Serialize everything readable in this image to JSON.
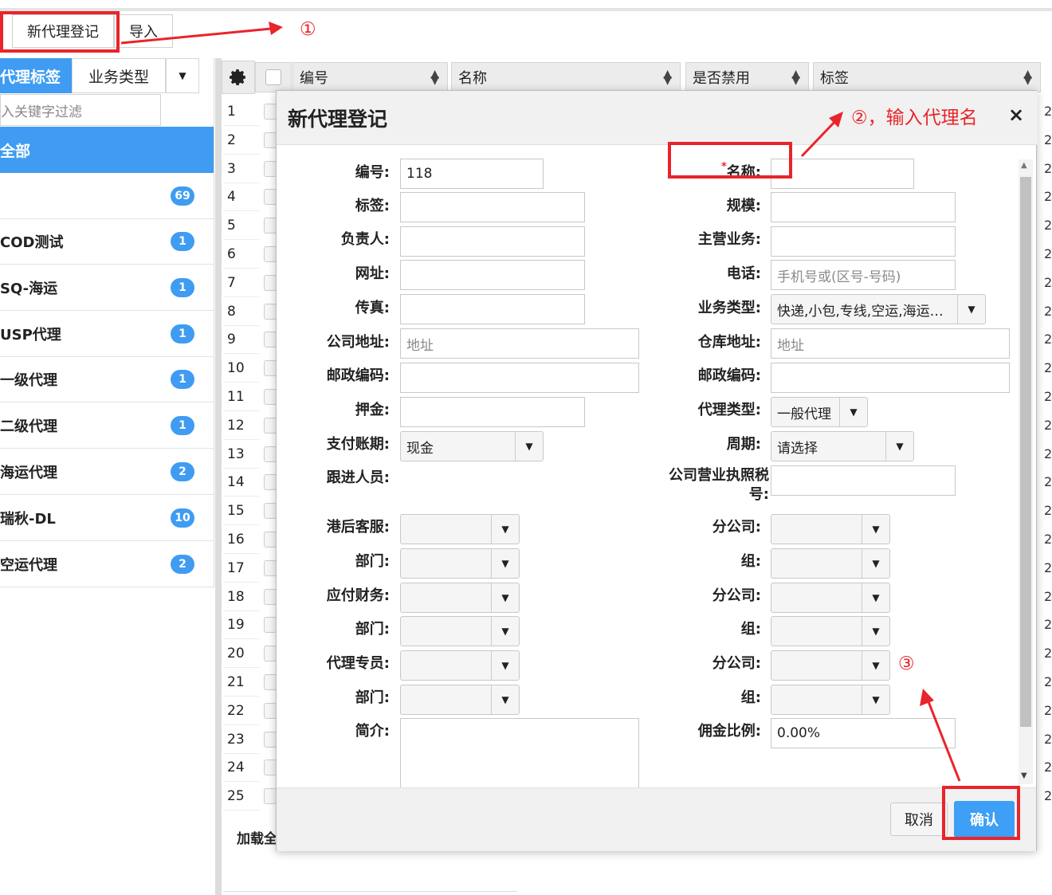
{
  "toolbar": {
    "new_label": "新代理登记",
    "import_label": "导入"
  },
  "annotations": {
    "step1": "①",
    "step2": "②，输入代理名",
    "step3": "③"
  },
  "left_panel": {
    "tab_tags": "代理标签",
    "tab_business": "业务类型",
    "filter_placeholder": "入关键字过滤",
    "all_label": "全部",
    "items": [
      {
        "label": "",
        "count": "69"
      },
      {
        "label": "COD测试",
        "count": "1"
      },
      {
        "label": "SQ-海运",
        "count": "1"
      },
      {
        "label": "USP代理",
        "count": "1"
      },
      {
        "label": "一级代理",
        "count": "1"
      },
      {
        "label": "二级代理",
        "count": "1"
      },
      {
        "label": "海运代理",
        "count": "2"
      },
      {
        "label": "瑞秋-DL",
        "count": "10"
      },
      {
        "label": "空运代理",
        "count": "2"
      }
    ]
  },
  "grid": {
    "columns": [
      "编号",
      "名称",
      "是否禁用",
      "标签"
    ],
    "rows": [
      "1",
      "2",
      "3",
      "4",
      "5",
      "6",
      "7",
      "8",
      "9",
      "10",
      "11",
      "12",
      "13",
      "14",
      "15",
      "16",
      "17",
      "18",
      "19",
      "20",
      "21",
      "22",
      "23",
      "24",
      "25"
    ],
    "right_cell": "2",
    "load_label": "加载全部"
  },
  "dialog": {
    "title": "新代理登记",
    "close": "×",
    "labels": {
      "code": "编号:",
      "name": "名称:",
      "tag": "标签:",
      "scale": "规模:",
      "owner": "负责人:",
      "main_business": "主营业务:",
      "website": "网址:",
      "phone": "电话:",
      "fax": "传真:",
      "business_type": "业务类型:",
      "company_address": "公司地址:",
      "warehouse_address": "仓库地址:",
      "postcode1": "邮政编码:",
      "postcode2": "邮政编码:",
      "deposit": "押金:",
      "agent_type": "代理类型:",
      "payment_term": "支付账期:",
      "period": "周期:",
      "follower": "跟进人员:",
      "tax_no": "公司营业执照税号:",
      "port_cs": "港后客服:",
      "branch1": "分公司:",
      "dept1": "部门:",
      "group1": "组:",
      "payable": "应付财务:",
      "branch2": "分公司:",
      "dept2": "部门:",
      "group2": "组:",
      "agent_staff": "代理专员:",
      "branch3": "分公司:",
      "dept3": "部门:",
      "group3": "组:",
      "intro": "简介:",
      "commission": "佣金比例:"
    },
    "values": {
      "code": "118",
      "phone_placeholder": "手机号或(区号-号码)",
      "business_type": "快递,小包,专线,空运,海运…",
      "address_placeholder": "地址",
      "warehouse_placeholder": "地址",
      "agent_type": "一般代理",
      "payment_term": "现金",
      "period": "请选择",
      "commission": "0.00%"
    },
    "required_mark": "*",
    "cancel_label": "取消",
    "ok_label": "确认"
  }
}
